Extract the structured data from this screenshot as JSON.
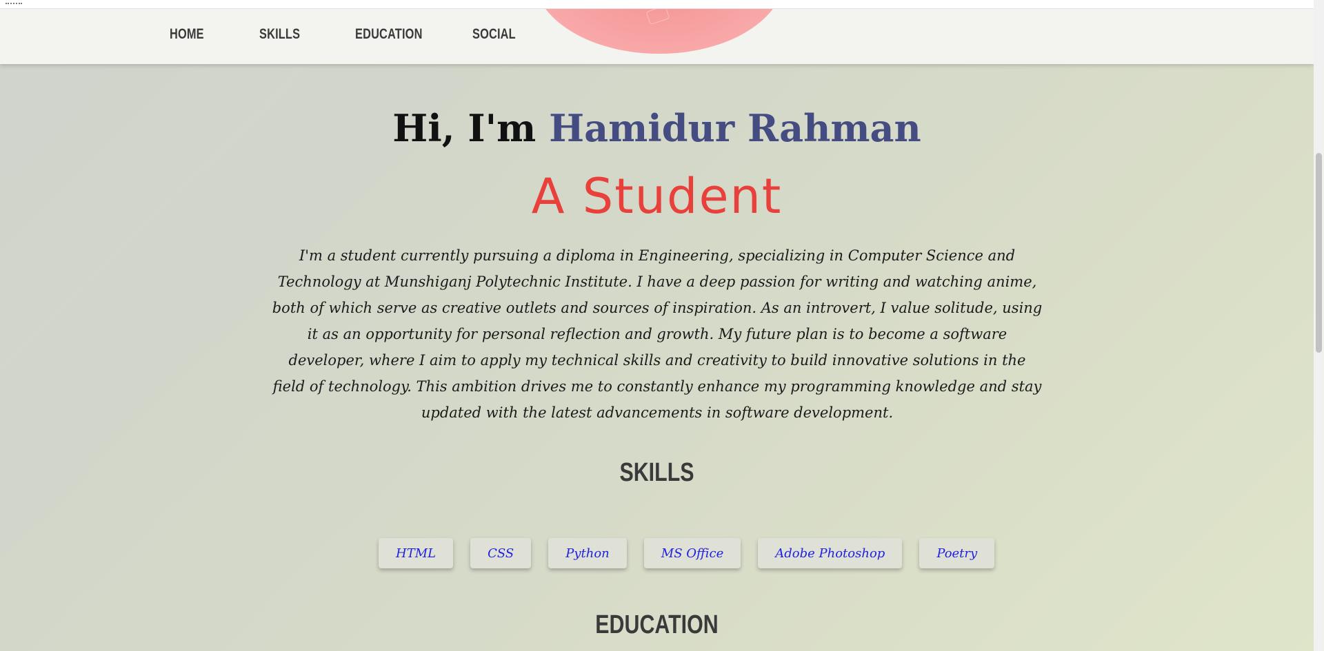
{
  "nav": {
    "items": [
      {
        "label": "HOME"
      },
      {
        "label": "SKILLS"
      },
      {
        "label": "EDUCATION"
      },
      {
        "label": "SOCIAL"
      }
    ]
  },
  "hero": {
    "greeting_prefix": "Hi, I'm ",
    "name": "Hamidur Rahman",
    "role": "A Student",
    "about": "I'm a student currently pursuing a diploma in Engineering, specializing in Computer Science and Technology at Munshiganj Polytechnic Institute. I have a deep passion for writing and watching anime, both of which serve as creative outlets and sources of inspiration. As an introvert, I value solitude, using it as an opportunity for personal reflection and growth. My future plan is to become a software developer, where I aim to apply my technical skills and creativity to build innovative solutions in the field of technology. This ambition drives me to constantly enhance my programming knowledge and stay updated with the latest advancements in software development."
  },
  "skills": {
    "title": "SKILLS",
    "items": [
      "HTML",
      "CSS",
      "Python",
      "MS Office",
      "Adobe Photoshop",
      "Poetry"
    ]
  },
  "education": {
    "title": "EDUCATION"
  },
  "colors": {
    "name": "#454c82",
    "role": "#e8403a",
    "skill_text": "#1f1fe0",
    "nav_text": "#3a3a3a"
  }
}
